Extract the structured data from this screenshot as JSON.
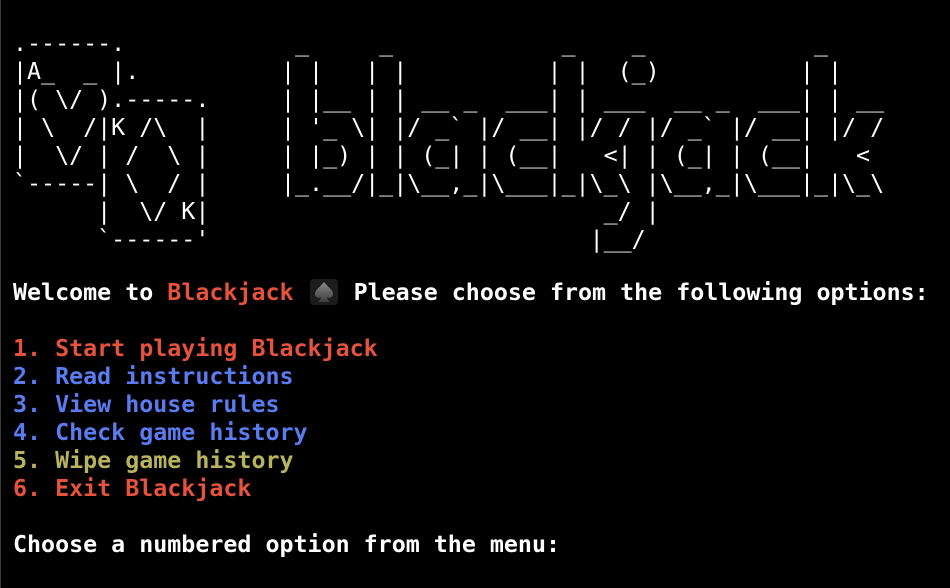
{
  "ascii_art": {
    "cards": ".------.\n|A_  _ |.\n|( \\/ ).-----.\n| \\  /|K /\\  |\n|  \\/ | /  \\ |\n`-----| \\  / |\n      |  \\/ K|\n      `------'",
    "logo": " _     _            _    _            _\n| |   | |          | |  (_)          | |\n| |__ | | __ _  ___| | ___  __ _  ___| | __\n| '_ \\| |/ _` |/ __| |/ / |/ _` |/ __| |/ /\n| |_) | | (_| | (__|   <| | (_| | (__|   <\n|_.__/|_|\\__,_|\\___|_|\\_\\ |\\__,_|\\___|_|\\_\\\n                       _/ |\n                      |__/"
  },
  "welcome": {
    "prefix": "Welcome to ",
    "brand": "Blackjack",
    "suffix": "Please choose from the following options:",
    "icon": "spade-icon"
  },
  "menu": {
    "options": [
      {
        "label": "1. Start playing Blackjack",
        "color": "#e5533e"
      },
      {
        "label": "2. Read instructions",
        "color": "#5b7cf0"
      },
      {
        "label": "3. View house rules",
        "color": "#5b7cf0"
      },
      {
        "label": "4. Check game history",
        "color": "#5b7cf0"
      },
      {
        "label": "5. Wipe game history",
        "color": "#b8b35c"
      },
      {
        "label": "6. Exit Blackjack",
        "color": "#e5533e"
      }
    ]
  },
  "prompt": "Choose a numbered option from the menu:",
  "colors": {
    "background": "#000000",
    "text": "#ffffff",
    "red": "#e5533e",
    "blue": "#5b7cf0",
    "yellow": "#b8b35c"
  }
}
